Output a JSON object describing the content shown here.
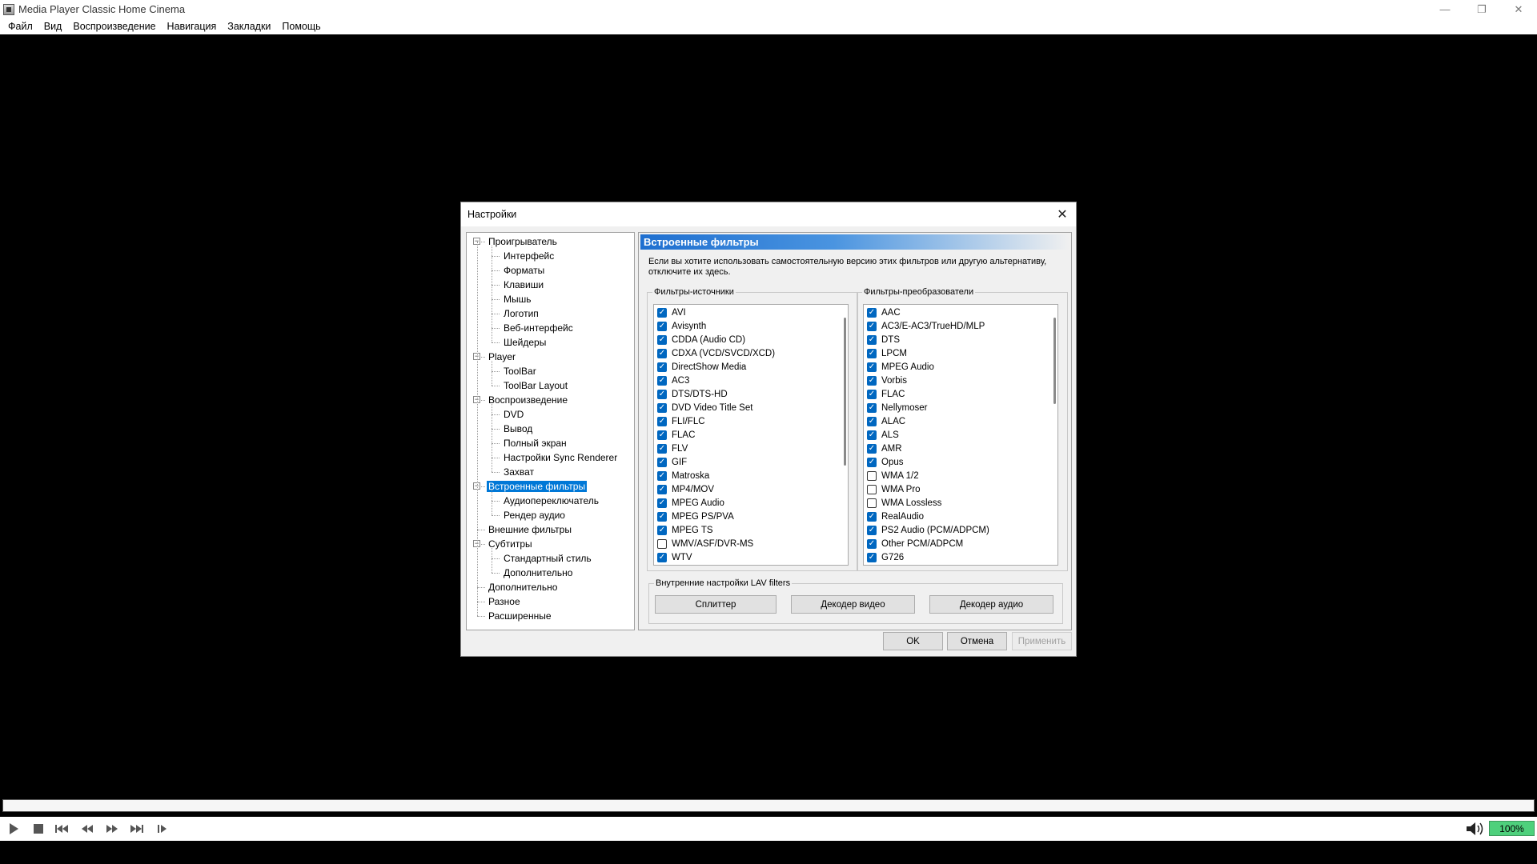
{
  "window": {
    "title": "Media Player Classic Home Cinema",
    "min": "—",
    "restore": "❐",
    "close": "✕"
  },
  "menu": [
    "Файл",
    "Вид",
    "Воспроизведение",
    "Навигация",
    "Закладки",
    "Помощь"
  ],
  "dialog": {
    "title": "Настройки",
    "close": "✕",
    "tree": [
      {
        "label": "Проигрыватель",
        "level": 0,
        "expander": "−"
      },
      {
        "label": "Интерфейс",
        "level": 1
      },
      {
        "label": "Форматы",
        "level": 1
      },
      {
        "label": "Клавиши",
        "level": 1
      },
      {
        "label": "Мышь",
        "level": 1
      },
      {
        "label": "Логотип",
        "level": 1
      },
      {
        "label": "Веб-интерфейс",
        "level": 1
      },
      {
        "label": "Шейдеры",
        "level": 1
      },
      {
        "label": "Player",
        "level": 0,
        "expander": "−"
      },
      {
        "label": "ToolBar",
        "level": 1
      },
      {
        "label": "ToolBar Layout",
        "level": 1
      },
      {
        "label": "Воспроизведение",
        "level": 0,
        "expander": "−"
      },
      {
        "label": "DVD",
        "level": 1
      },
      {
        "label": "Вывод",
        "level": 1
      },
      {
        "label": "Полный экран",
        "level": 1
      },
      {
        "label": "Настройки Sync Renderer",
        "level": 1
      },
      {
        "label": "Захват",
        "level": 1
      },
      {
        "label": "Встроенные фильтры",
        "level": 0,
        "expander": "−",
        "selected": true
      },
      {
        "label": "Аудиопереключатель",
        "level": 1
      },
      {
        "label": "Рендер аудио",
        "level": 1
      },
      {
        "label": "Внешние фильтры",
        "level": 0
      },
      {
        "label": "Субтитры",
        "level": 0,
        "expander": "−"
      },
      {
        "label": "Стандартный стиль",
        "level": 1
      },
      {
        "label": "Дополнительно",
        "level": 1
      },
      {
        "label": "Дополнительно",
        "level": 0
      },
      {
        "label": "Разное",
        "level": 0
      },
      {
        "label": "Расширенные",
        "level": 0
      }
    ],
    "panel": {
      "header": "Встроенные фильтры",
      "description_line1": "Если вы хотите использовать самостоятельную версию этих фильтров или другую альтернативу,",
      "description_line2": "отключите их здесь.",
      "sources_title": "Фильтры-источники",
      "sources": [
        {
          "label": "AVI",
          "checked": true
        },
        {
          "label": "Avisynth",
          "checked": true
        },
        {
          "label": "CDDA (Audio CD)",
          "checked": true
        },
        {
          "label": "CDXA (VCD/SVCD/XCD)",
          "checked": true
        },
        {
          "label": "DirectShow Media",
          "checked": true
        },
        {
          "label": "AC3",
          "checked": true
        },
        {
          "label": "DTS/DTS-HD",
          "checked": true
        },
        {
          "label": "DVD Video Title Set",
          "checked": true
        },
        {
          "label": "FLI/FLC",
          "checked": true
        },
        {
          "label": "FLAC",
          "checked": true
        },
        {
          "label": "FLV",
          "checked": true
        },
        {
          "label": "GIF",
          "checked": true
        },
        {
          "label": "Matroska",
          "checked": true
        },
        {
          "label": "MP4/MOV",
          "checked": true
        },
        {
          "label": "MPEG Audio",
          "checked": true
        },
        {
          "label": "MPEG PS/PVA",
          "checked": true
        },
        {
          "label": "MPEG TS",
          "checked": true
        },
        {
          "label": "WMV/ASF/DVR-MS",
          "checked": false
        },
        {
          "label": "WTV",
          "checked": true
        }
      ],
      "transforms_title": "Фильтры-преобразователи",
      "transforms": [
        {
          "label": "AAC",
          "checked": true
        },
        {
          "label": "AC3/E-AC3/TrueHD/MLP",
          "checked": true
        },
        {
          "label": "DTS",
          "checked": true
        },
        {
          "label": "LPCM",
          "checked": true
        },
        {
          "label": "MPEG Audio",
          "checked": true
        },
        {
          "label": "Vorbis",
          "checked": true
        },
        {
          "label": "FLAC",
          "checked": true
        },
        {
          "label": "Nellymoser",
          "checked": true
        },
        {
          "label": "ALAC",
          "checked": true
        },
        {
          "label": "ALS",
          "checked": true
        },
        {
          "label": "AMR",
          "checked": true
        },
        {
          "label": "Opus",
          "checked": true
        },
        {
          "label": "WMA 1/2",
          "checked": false
        },
        {
          "label": "WMA Pro",
          "checked": false
        },
        {
          "label": "WMA Lossless",
          "checked": false
        },
        {
          "label": "RealAudio",
          "checked": true
        },
        {
          "label": "PS2 Audio (PCM/ADPCM)",
          "checked": true
        },
        {
          "label": "Other PCM/ADPCM",
          "checked": true
        },
        {
          "label": "G726",
          "checked": true
        }
      ],
      "lav_title": "Внутренние настройки LAV filters",
      "lav_buttons": [
        "Сплиттер",
        "Декодер видео",
        "Декодер аудио"
      ]
    },
    "buttons": {
      "ok": "OK",
      "cancel": "Отмена",
      "apply": "Применить"
    }
  },
  "player": {
    "zoom": "100%"
  },
  "colors": {
    "selection": "#0078d7",
    "checkbox": "#0067c0",
    "volume_box": "#4ed07c"
  }
}
